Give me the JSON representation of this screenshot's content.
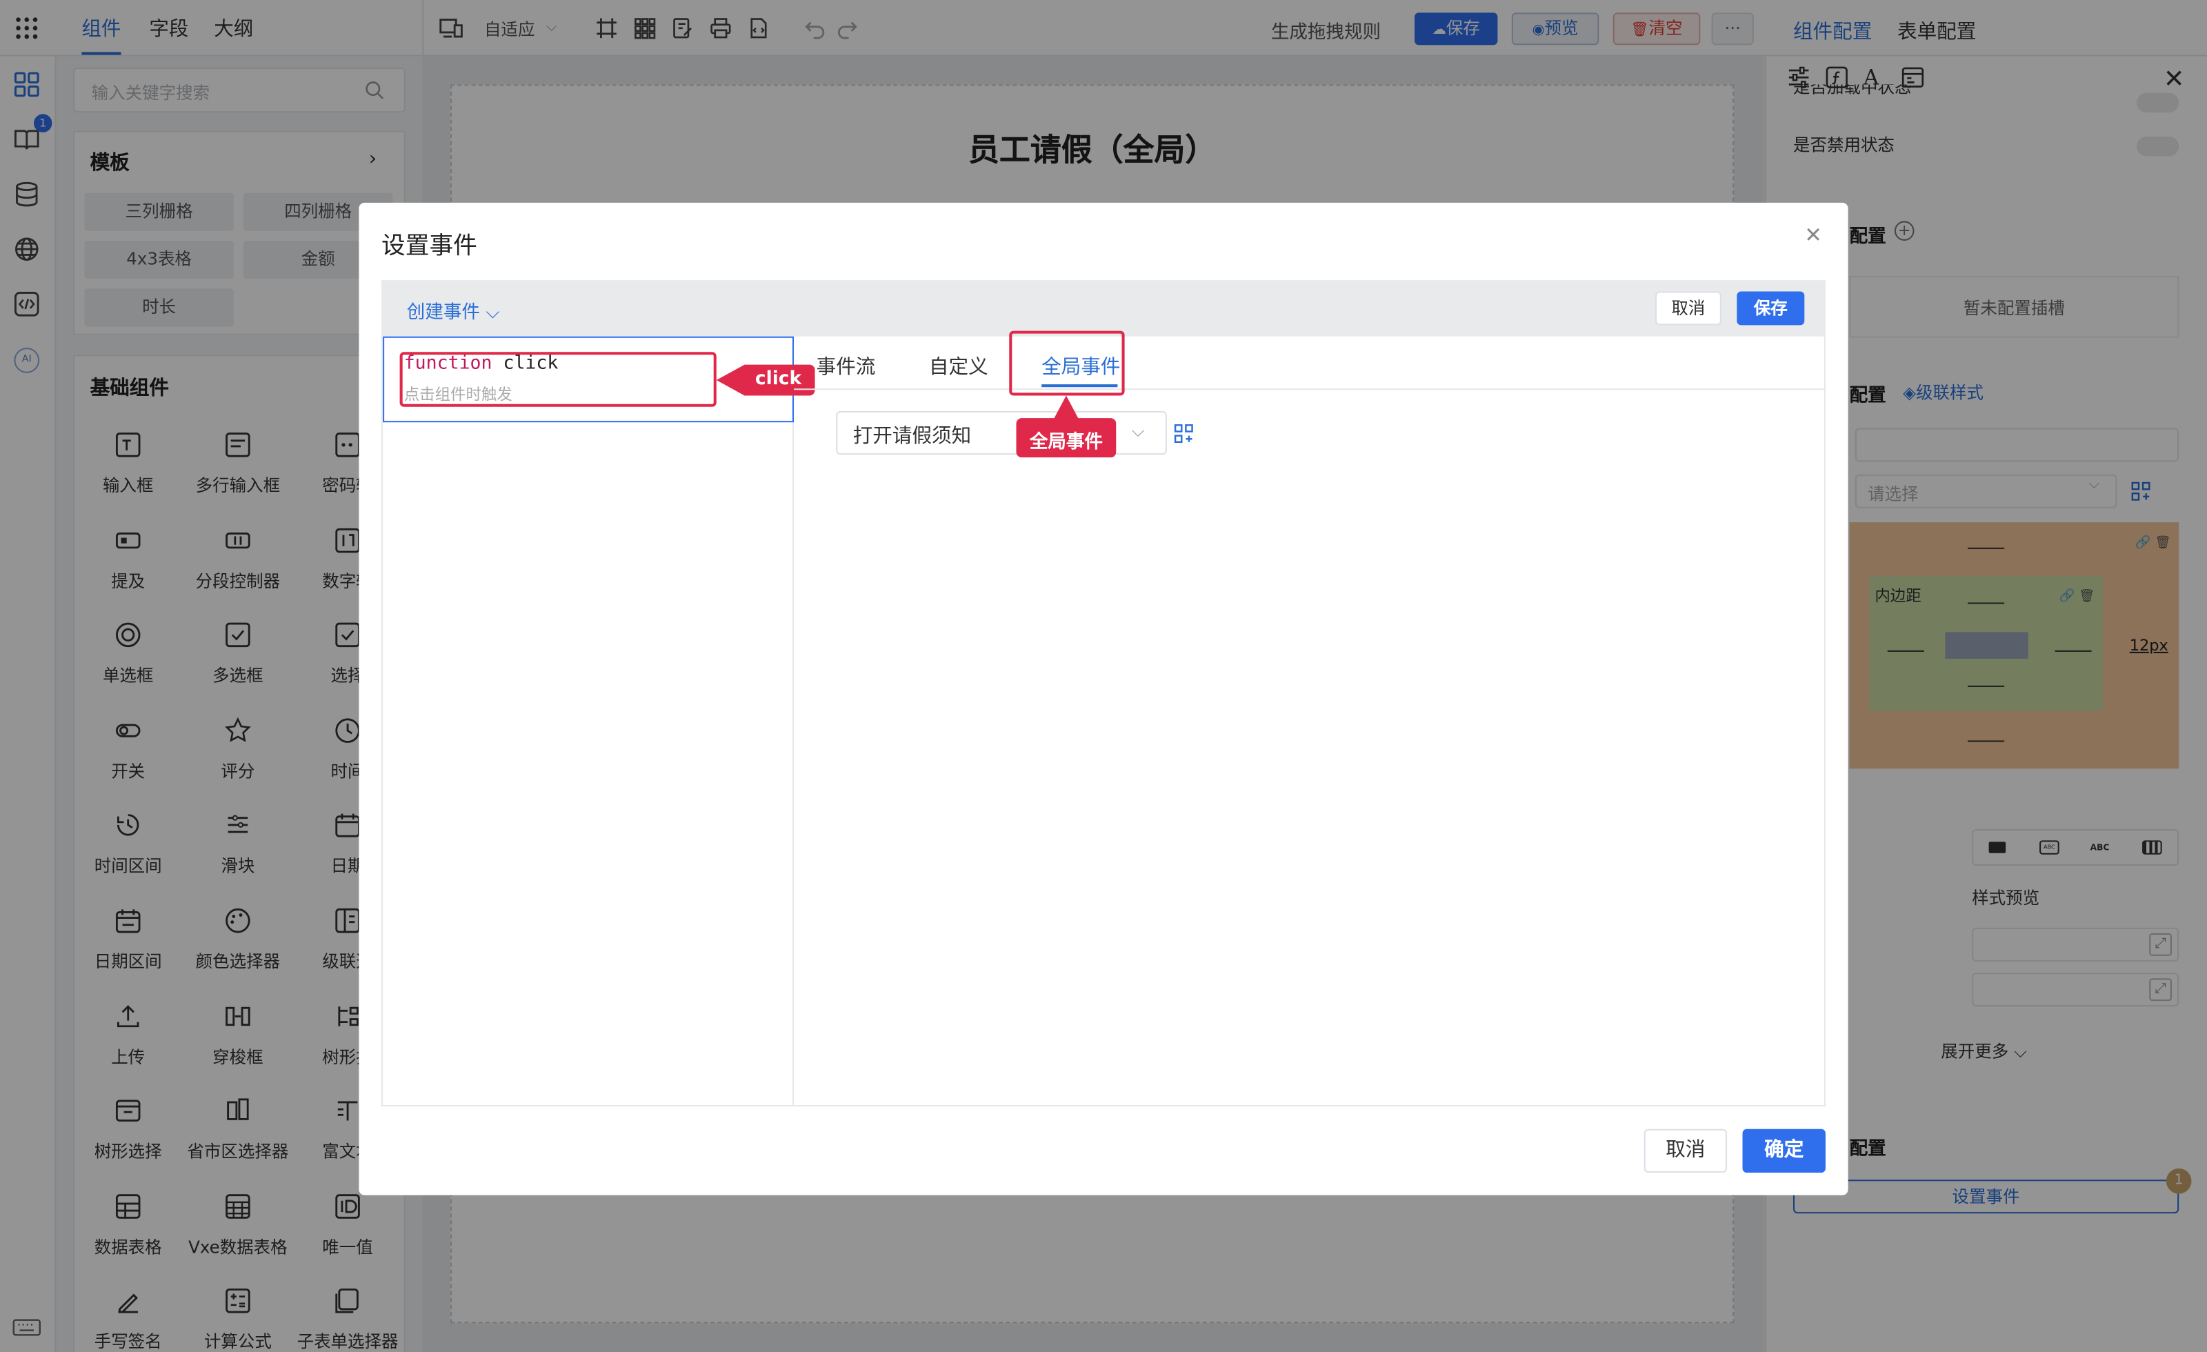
{
  "top_tabs": [
    "组件",
    "字段",
    "大纲"
  ],
  "search_placeholder": "输入关键字搜索",
  "templates": {
    "title": "模板",
    "items": [
      "三列栅格",
      "四列栅格",
      "4x3表格",
      "金额",
      "时长"
    ]
  },
  "basic": {
    "title": "基础组件",
    "items": [
      "输入框",
      "多行输入框",
      "密码输",
      "提及",
      "分段控制器",
      "数字输",
      "单选框",
      "多选框",
      "选择",
      "开关",
      "评分",
      "时间",
      "时间区间",
      "滑块",
      "日期",
      "日期区间",
      "颜色选择器",
      "级联选",
      "上传",
      "穿梭框",
      "树形打",
      "树形选择",
      "省市区选择器",
      "富文本",
      "数据表格",
      "Vxe数据表格",
      "唯一值",
      "手写签名",
      "计算公式",
      "子表单选择器"
    ]
  },
  "toolbar": {
    "adaptive": "自适应",
    "gen_rules": "生成拖拽规则",
    "save": "保存",
    "preview": "预览",
    "clear": "清空",
    "more": "···"
  },
  "rail_badge": "1",
  "canvas_title": "员工请假（全局）",
  "right": {
    "tabs": [
      "组件配置",
      "表单配置"
    ],
    "loading_label": "是否加载中状态",
    "disabled_label": "是否禁用状态",
    "plugin_title": "配置",
    "plugin_empty": "暂未配置插槽",
    "style_title": "配置",
    "cascade_style": "级联样式",
    "select_placeholder": "请选择",
    "padding_label": "内边距",
    "padding_value": "12px",
    "style_preview": "样式预览",
    "expand_more": "展开更多",
    "event_title": "配置",
    "set_event": "设置事件",
    "event_badge": "1"
  },
  "modal": {
    "title": "设置事件",
    "create_event": "创建事件",
    "cancel_small": "取消",
    "save_small": "保存",
    "fn_keyword": "function",
    "fn_name": "click",
    "fn_desc": "点击组件时触发",
    "tabs": [
      "事件流",
      "自定义",
      "全局事件"
    ],
    "select_value": "打开请假须知",
    "cancel": "取消",
    "confirm": "确定"
  },
  "callouts": {
    "click": "click",
    "global": "全局事件"
  },
  "colors": {
    "accent": "#2b6fd6",
    "primary_btn": "#2f6fed",
    "callout": "#e0284a",
    "padding_outer": "#f0c49a",
    "padding_inner": "#c9d9a3"
  }
}
